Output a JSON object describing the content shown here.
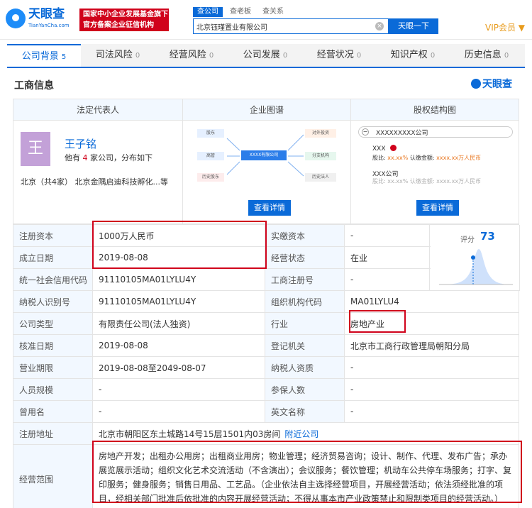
{
  "header": {
    "logo_cn": "天眼查",
    "logo_en": "TianYanCha.com",
    "slogan_1": "国家中小企业发展基金旗下",
    "slogan_2": "官方备案企业征信机构",
    "search_tabs": [
      "查公司",
      "查老板",
      "查关系"
    ],
    "search_value": "北京钰瑾置业有限公司",
    "search_button": "天眼一下",
    "vip": "VIP会员 ▼"
  },
  "nav": [
    {
      "label": "公司背景",
      "count": "5"
    },
    {
      "label": "司法风险",
      "count": "0"
    },
    {
      "label": "经营风险",
      "count": "0"
    },
    {
      "label": "公司发展",
      "count": "0"
    },
    {
      "label": "经营状况",
      "count": "0"
    },
    {
      "label": "知识产权",
      "count": "0"
    },
    {
      "label": "历史信息",
      "count": "0"
    }
  ],
  "section": {
    "title": "工商信息",
    "brand": "天眼查"
  },
  "legal": {
    "header": "法定代表人",
    "avatar": "王",
    "name": "王子铭",
    "sub_pre": "他有 ",
    "sub_count": "4",
    "sub_post": " 家公司，分布如下",
    "foot": "北京（共4家）    北京金隅启迪科技孵化...等"
  },
  "map": {
    "header": "企业图谱",
    "button": "查看详情",
    "nodes": [
      "股东",
      "对外投资",
      "高管",
      "XXXX有限公司",
      "分支机构",
      "历史股东",
      "历史法人"
    ]
  },
  "equity": {
    "header": "股权结构图",
    "button": "查看详情",
    "company": "XXXXXXXXX公司",
    "holder": "XXX",
    "share_lbl": "股比:",
    "share": "xx.xx%",
    "capital_lbl": "认缴金额:",
    "capital": "xxxx.xx万人民币",
    "company2": "XXX公司"
  },
  "score": {
    "label": "评分",
    "value": "73"
  },
  "rows": [
    [
      "注册资本",
      "1000万人民币",
      "实缴资本",
      "-"
    ],
    [
      "成立日期",
      "2019-08-08",
      "经营状态",
      "在业"
    ],
    [
      "统一社会信用代码",
      "91110105MA01LYLU4Y",
      "工商注册号",
      "-"
    ],
    [
      "纳税人识别号",
      "91110105MA01LYLU4Y",
      "组织机构代码",
      "MA01LYLU4"
    ],
    [
      "公司类型",
      "有限责任公司(法人独资)",
      "行业",
      "房地产业"
    ],
    [
      "核准日期",
      "2019-08-08",
      "登记机关",
      "北京市工商行政管理局朝阳分局"
    ],
    [
      "营业期限",
      "2019-08-08至2049-08-07",
      "纳税人资质",
      "-"
    ],
    [
      "人员规模",
      "-",
      "参保人数",
      "-"
    ],
    [
      "曾用名",
      "-",
      "英文名称",
      "-"
    ]
  ],
  "address": {
    "label": "注册地址",
    "value": "北京市朝阳区东土城路14号15层1501内03房间",
    "link": "附近公司"
  },
  "scope": {
    "label": "经营范围",
    "value": "房地产开发；出租办公用房；出租商业用房；物业管理；经济贸易咨询；设计、制作、代理、发布广告；承办展览展示活动；组织文化艺术交流活动（不含演出）；会议服务；餐饮管理；机动车公共停车场服务；打字、复印服务；健身服务；销售日用品、工艺品。（企业依法自主选择经营项目，开展经营活动；依法须经批准的项目，经相关部门批准后依批准的内容开展经营活动；不得从事本市产业政策禁止和限制类项目的经营活动。）"
  },
  "colors": {
    "accent": "#0a6ad8",
    "highlight": "#d0021b"
  }
}
